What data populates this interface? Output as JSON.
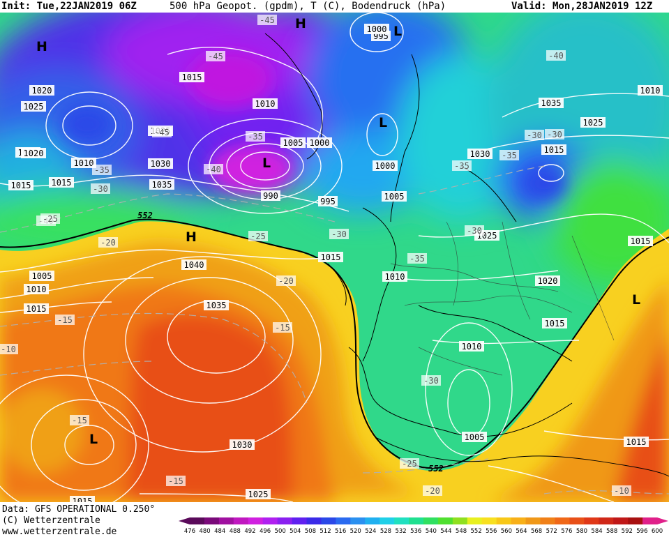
{
  "header": {
    "init": "Init: Tue,22JAN2019 06Z",
    "title": "500 hPa Geopot. (gpdm), T (C), Bodendruck (hPa)",
    "valid": "Valid: Mon,28JAN2019 12Z"
  },
  "footer": {
    "data_line": "Data: GFS OPERATIONAL 0.250°",
    "copyright_line": "(C) Wetterzentrale",
    "url_line": "www.wetterzentrale.de"
  },
  "colorbar": {
    "ticks": [
      "476",
      "480",
      "484",
      "488",
      "492",
      "496",
      "500",
      "504",
      "508",
      "512",
      "516",
      "520",
      "524",
      "528",
      "532",
      "536",
      "540",
      "544",
      "548",
      "552",
      "556",
      "560",
      "564",
      "568",
      "572",
      "576",
      "580",
      "584",
      "588",
      "592",
      "596",
      "600"
    ],
    "colors": [
      "#5a0a5a",
      "#7a0a7a",
      "#a010a0",
      "#c018c0",
      "#d020e0",
      "#b020f0",
      "#8a20f0",
      "#6020f0",
      "#3a2ae8",
      "#2a48e8",
      "#2a6af0",
      "#2a90f0",
      "#20b0f0",
      "#20d0e8",
      "#20e0c0",
      "#20e090",
      "#30e060",
      "#50e030",
      "#90e020",
      "#e8f020",
      "#f8e020",
      "#f8c818",
      "#f8b018",
      "#f09818",
      "#f08018",
      "#f06818",
      "#e85018",
      "#e03818",
      "#d02818",
      "#c01818",
      "#a81010",
      "#e0208a"
    ]
  },
  "labels": {
    "pressure": [
      "1015",
      "1020",
      "1025",
      "1010",
      "1020",
      "1010",
      "1015",
      "1030",
      "1035",
      "1025",
      "1015",
      "1005",
      "1010",
      "1015",
      "1040",
      "1035",
      "1030",
      "1025",
      "1015",
      "1010",
      "1005",
      "990",
      "995",
      "1000",
      "1000",
      "995",
      "1005",
      "1000",
      "1010",
      "1015",
      "1030",
      "1015",
      "1025",
      "1035",
      "1010",
      "1015",
      "1020",
      "1025",
      "1015",
      "1010",
      "1005",
      "1015"
    ],
    "temperature": [
      "-45",
      "-45",
      "-45",
      "-40",
      "-35",
      "-35",
      "-30",
      "-40",
      "-30",
      "-25",
      "-20",
      "-35",
      "-25",
      "-20",
      "-15",
      "-15",
      "-15",
      "-15",
      "-10",
      "-20",
      "-25",
      "-30",
      "-35",
      "-30",
      "-35",
      "-30",
      "-40",
      "-30",
      "-10"
    ],
    "highs": [
      "H",
      "H",
      "H"
    ],
    "lows": [
      "L",
      "L",
      "L",
      "L",
      "L"
    ],
    "geopotential_552": [
      "552",
      "552"
    ]
  }
}
